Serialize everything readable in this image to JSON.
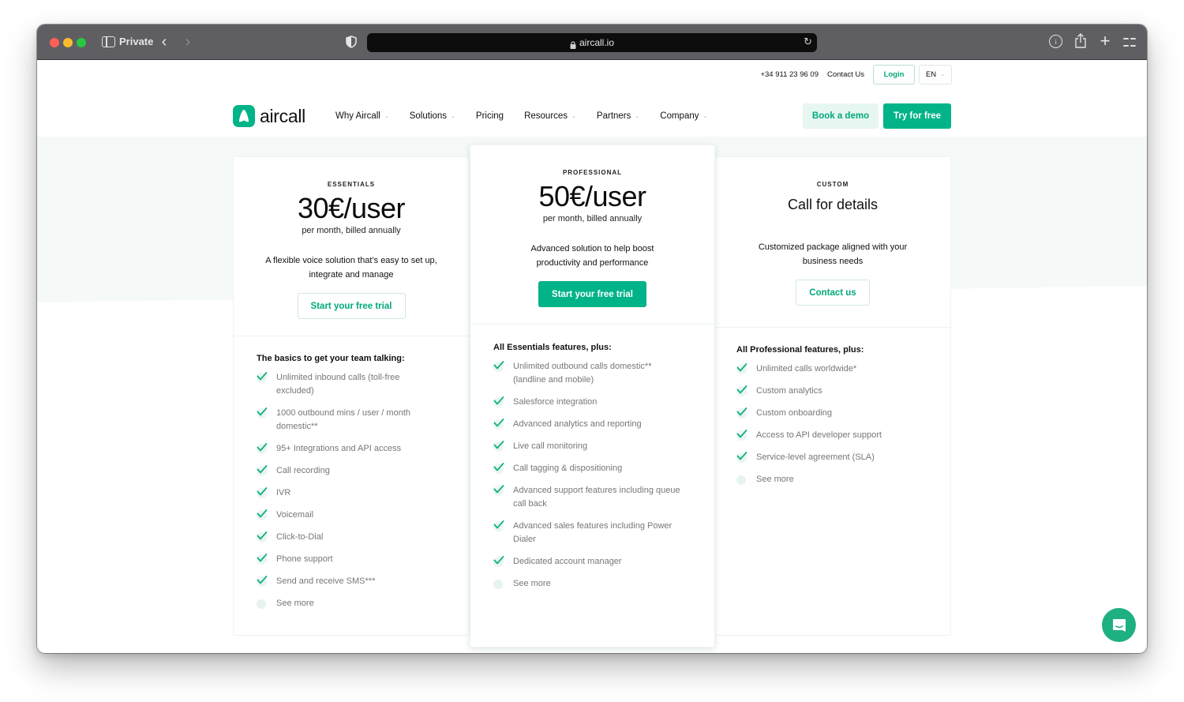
{
  "browser": {
    "mode_label": "Private",
    "url": "aircall.io"
  },
  "topbar": {
    "phone": "+34 911 23 96 09",
    "contact": "Contact Us",
    "login": "Login",
    "language": "EN"
  },
  "nav": {
    "logo_text": "aircall",
    "items": [
      {
        "label": "Why Aircall",
        "has_dropdown": true
      },
      {
        "label": "Solutions",
        "has_dropdown": true
      },
      {
        "label": "Pricing",
        "has_dropdown": false
      },
      {
        "label": "Resources",
        "has_dropdown": true
      },
      {
        "label": "Partners",
        "has_dropdown": true
      },
      {
        "label": "Company",
        "has_dropdown": true
      }
    ],
    "book_demo": "Book a demo",
    "try_free": "Try for free"
  },
  "plans": [
    {
      "tier": "ESSENTIALS",
      "price": "30€/user",
      "billing": "per month, billed annually",
      "description": "A flexible voice solution that’s easy to set up, integrate and manage",
      "cta": "Start your free trial",
      "features_title": "The basics to get your team talking:",
      "features": [
        "Unlimited inbound calls (toll-free excluded)",
        "1000 outbound mins / user / month domestic**",
        "95+ Integrations and API access",
        "Call recording",
        "IVR",
        "Voicemail",
        "Click-to-Dial",
        "Phone support",
        "Send and receive SMS***"
      ],
      "see_more": "See more"
    },
    {
      "tier": "PROFESSIONAL",
      "price": "50€/user",
      "billing": "per month, billed annually",
      "description": "Advanced solution to help boost productivity and performance",
      "cta": "Start your free trial",
      "features_title": "All Essentials features, plus:",
      "features": [
        "Unlimited outbound calls domestic** (landline and mobile)",
        "Salesforce integration",
        "Advanced analytics and reporting",
        "Live call monitoring",
        "Call tagging & dispositioning",
        "Advanced support features including queue call back",
        "Advanced sales features including Power Dialer",
        "Dedicated account manager"
      ],
      "see_more": "See more"
    },
    {
      "tier": "CUSTOM",
      "price": "Call for details",
      "description": "Customized package aligned with your business needs",
      "cta": "Contact us",
      "features_title": "All Professional features, plus:",
      "features": [
        "Unlimited calls worldwide*",
        "Custom analytics",
        "Custom onboarding",
        "Access to API developer support",
        "Service-level agreement (SLA)"
      ],
      "see_more": "See more"
    }
  ],
  "colors": {
    "brand": "#00b388",
    "brand_text": "#00a97c",
    "mint_bg": "#f5f9f8",
    "demo_bg": "#e7f6f1"
  }
}
